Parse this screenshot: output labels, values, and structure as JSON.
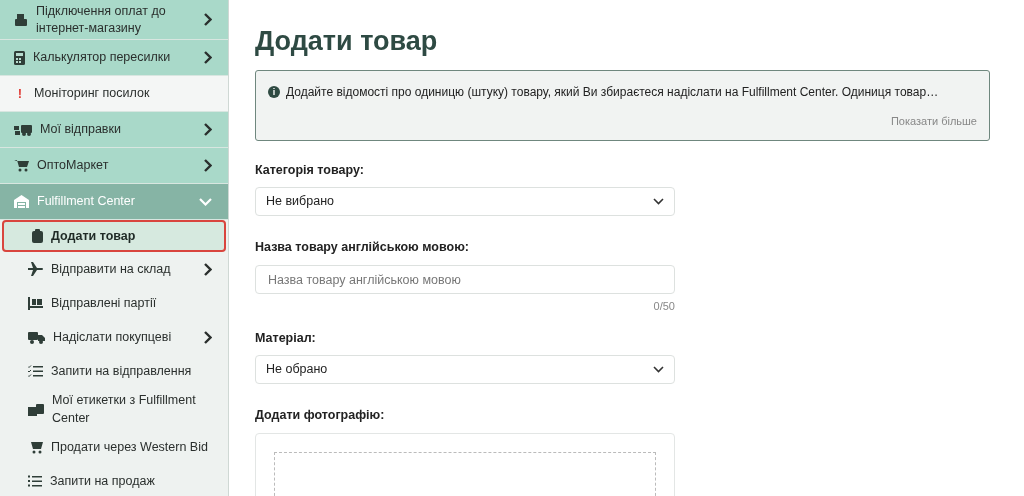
{
  "sidebar": {
    "items": [
      {
        "label": "Підключення оплат до інтернет-магазину",
        "kind": "menu",
        "expanded": false
      },
      {
        "label": "Калькулятор пересилки",
        "kind": "menu",
        "expanded": false
      },
      {
        "label": "Моніторинг посилок",
        "kind": "alert",
        "icon": "!"
      },
      {
        "label": "Мої відправки",
        "kind": "menu",
        "expanded": false
      },
      {
        "label": "ОптоМаркет",
        "kind": "menu",
        "expanded": false
      },
      {
        "label": "Fulfillment Center",
        "kind": "menu",
        "expanded": true,
        "children": [
          {
            "label": "Додати товар",
            "selected": true
          },
          {
            "label": "Відправити на склад",
            "selected": false,
            "expanded": false
          },
          {
            "label": "Відправлені партії",
            "selected": false
          },
          {
            "label": "Надіслати покупцеві",
            "selected": false,
            "expanded": false
          },
          {
            "label": "Запити на відправлення",
            "selected": false
          },
          {
            "label": "Мої етикетки з Fulfillment Center",
            "selected": false
          },
          {
            "label": "Продати через Western Bid",
            "selected": false
          },
          {
            "label": "Запити на продаж",
            "selected": false
          }
        ]
      }
    ]
  },
  "page": {
    "title": "Додати товар",
    "notice": {
      "icon": "i",
      "text": "Додайте відомості про одиницю (штуку) товару, який Ви збираєтеся надіслати на Fulfillment Center. Одиниця товар…",
      "link": "Показати більше"
    },
    "fields": [
      {
        "kind": "select",
        "label": "Категорія товару:",
        "value": "Не вибрано"
      },
      {
        "kind": "text",
        "label": "Назва товару англійською мовою:",
        "placeholder": "Назва товару англійською мовою",
        "counter": "0/50"
      },
      {
        "kind": "select",
        "label": "Матеріал:",
        "value": "Не обрано"
      },
      {
        "kind": "upload",
        "label": "Додати фотографію:"
      }
    ]
  }
}
